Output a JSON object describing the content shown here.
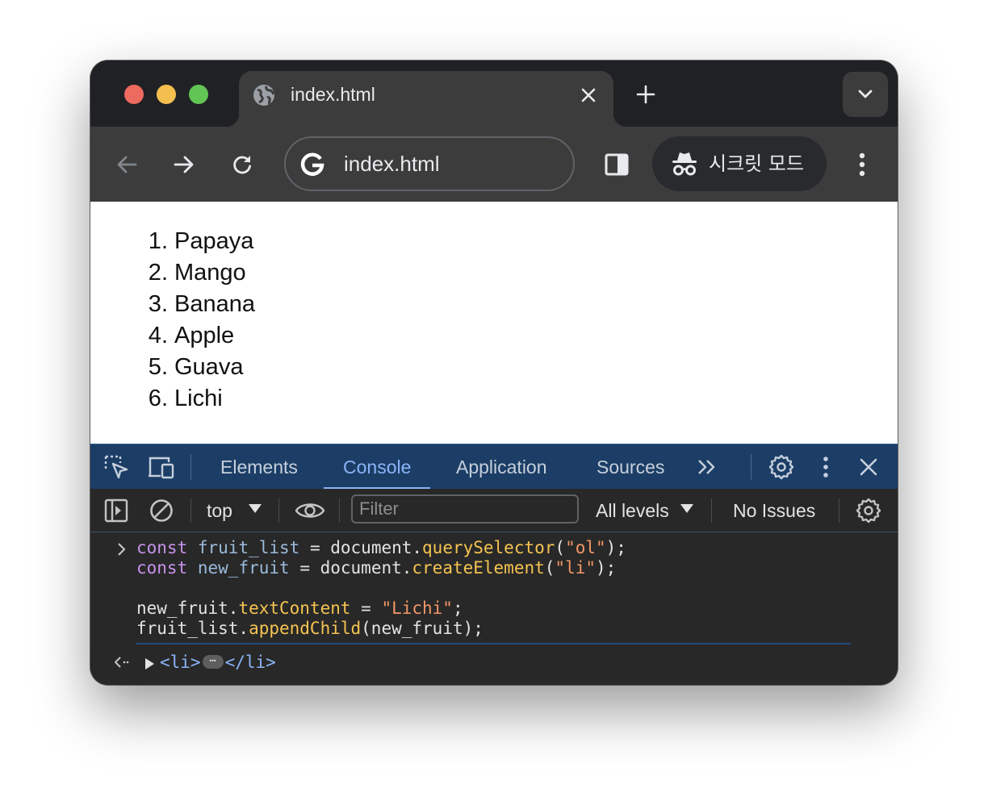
{
  "browser": {
    "tab": {
      "title": "index.html"
    },
    "omnibox": {
      "url": "index.html"
    },
    "incognito_label": "시크릿 모드"
  },
  "page": {
    "fruits": [
      {
        "num": "1",
        "text": "Papaya"
      },
      {
        "num": "2",
        "text": "Mango"
      },
      {
        "num": "3",
        "text": "Banana"
      },
      {
        "num": "4",
        "text": "Apple"
      },
      {
        "num": "5",
        "text": "Guava"
      },
      {
        "num": "6",
        "text": "Lichi"
      }
    ]
  },
  "devtools": {
    "tabs": [
      "Elements",
      "Console",
      "Application",
      "Sources"
    ],
    "active_tab": "Console",
    "more_tabs_symbol": "»",
    "context": "top",
    "filter_placeholder": "Filter",
    "levels": "All levels",
    "issues": "No Issues",
    "code": {
      "l1": {
        "kw": "const",
        "var": "fruit_list",
        "op": " = document.",
        "fn": "querySelector",
        "open": "(",
        "str": "\"ol\"",
        "close": ");"
      },
      "l2": {
        "kw": "const",
        "var": "new_fruit",
        "op": " = document.",
        "fn": "createElement",
        "open": "(",
        "str": "\"li\"",
        "close": ");"
      },
      "l3": {
        "obj": "new_fruit.",
        "prop": "textContent",
        "op": " = ",
        "str": "\"Lichi\"",
        "end": ";"
      },
      "l4": {
        "obj": "fruit_list.",
        "fn": "appendChild",
        "rest": "(new_fruit);"
      }
    },
    "result": {
      "open_tag": "<li>",
      "ellipsis": "…",
      "close_tag": "</li>"
    }
  },
  "colors": {
    "traffic_red": "#ed6a5e",
    "traffic_yellow": "#f5bf4f",
    "traffic_green": "#61c454",
    "devtools_tabbar": "#1c3e66",
    "accent": "#8ab4f8"
  }
}
